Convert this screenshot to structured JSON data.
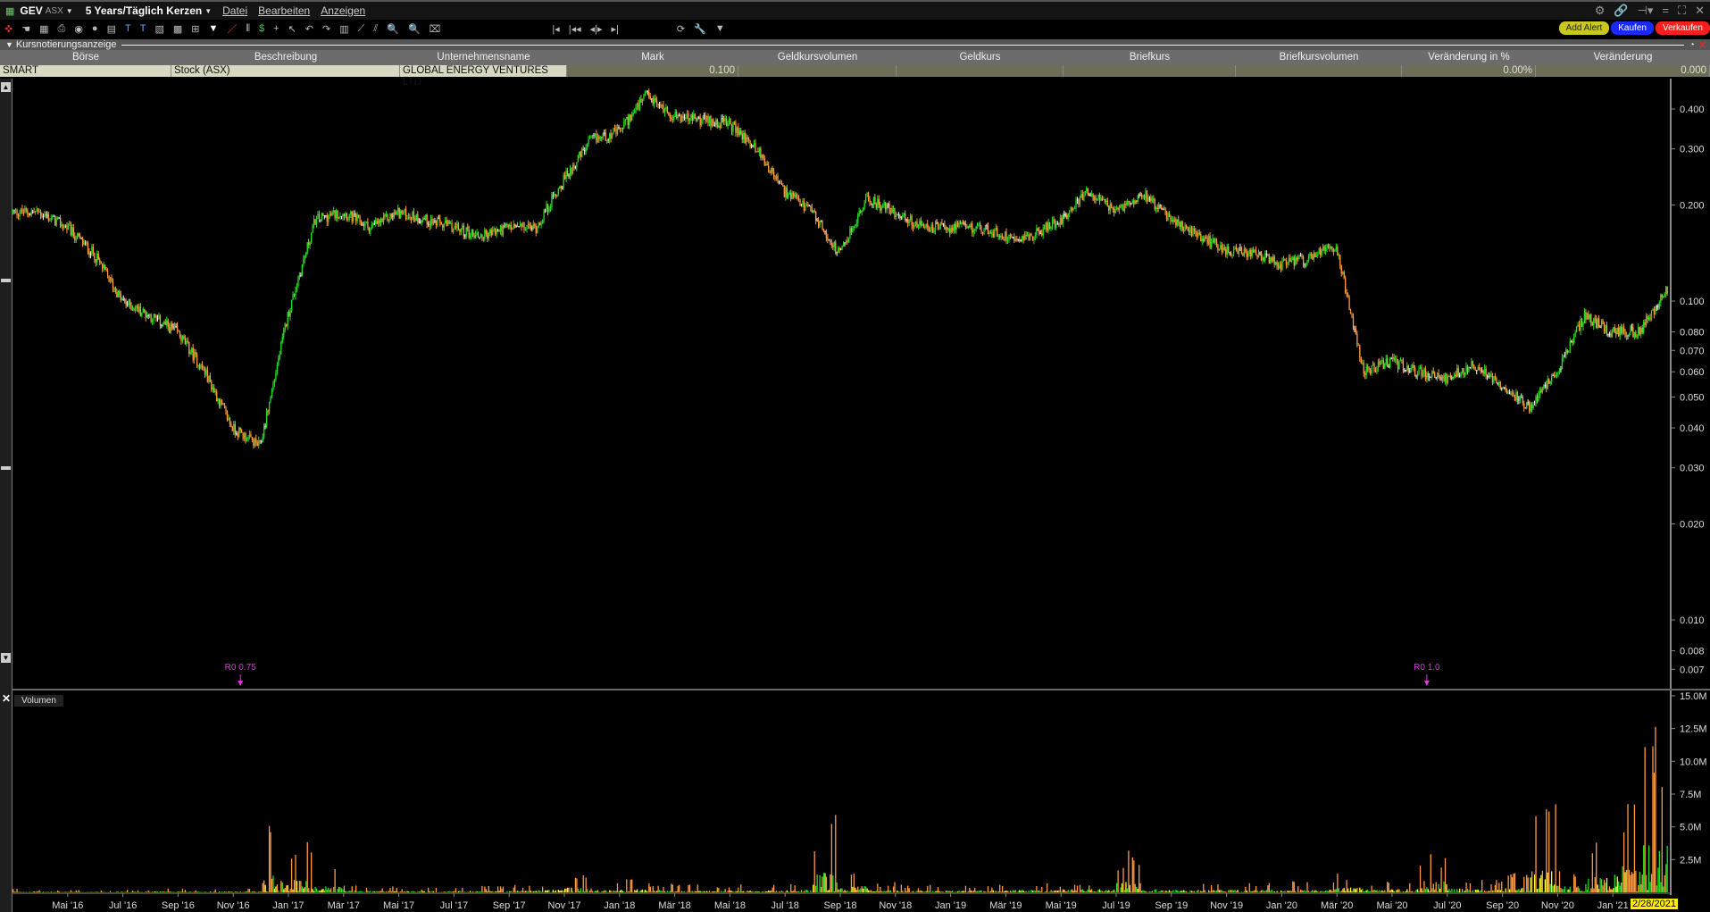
{
  "window": {
    "symbol": "GEV",
    "exchange": "ASX",
    "period": "5 Years/Täglich Kerzen",
    "menus": [
      "Datei",
      "Bearbeiten",
      "Anzeigen"
    ]
  },
  "buttons": {
    "add_alert": "Add Alert",
    "buy": "Kaufen",
    "sell": "Verkaufen"
  },
  "panel": {
    "title": "Kursnotierungsanzeige"
  },
  "quote": {
    "columns": [
      "Börse",
      "Beschreibung",
      "Unternehmensname",
      "Mark",
      "Geldkursvolumen",
      "Geldkurs",
      "Briefkurs",
      "Briefkursvolumen",
      "Veränderung in %",
      "Veränderung"
    ],
    "row": [
      "SMART",
      "Stock (ASX)",
      "GLOBAL ENERGY VENTURES LTD",
      "0.100",
      "",
      "",
      "",
      "",
      "0.00%",
      "0.000"
    ]
  },
  "volume_panel": {
    "label": "Volumen"
  },
  "cursor_date": "2/28/2021",
  "colors": {
    "up": "#22dd22",
    "down": "#ff9a40",
    "neutral": "#ffff33",
    "marker": "#dd33dd"
  },
  "chart_data": [
    {
      "type": "candlestick",
      "scale": "log",
      "months": [
        "2016-03",
        "2016-04",
        "2016-05",
        "2016-06",
        "2016-07",
        "2016-08",
        "2016-09",
        "2016-10",
        "2016-11",
        "2016-12",
        "2017-01",
        "2017-02",
        "2017-03",
        "2017-04",
        "2017-05",
        "2017-06",
        "2017-07",
        "2017-08",
        "2017-09",
        "2017-10",
        "2017-11",
        "2017-12",
        "2018-01",
        "2018-02",
        "2018-03",
        "2018-04",
        "2018-05",
        "2018-06",
        "2018-07",
        "2018-08",
        "2018-09",
        "2018-10",
        "2018-11",
        "2018-12",
        "2019-01",
        "2019-02",
        "2019-03",
        "2019-04",
        "2019-05",
        "2019-06",
        "2019-07",
        "2019-08",
        "2019-09",
        "2019-10",
        "2019-11",
        "2019-12",
        "2020-01",
        "2020-02",
        "2020-03",
        "2020-04",
        "2020-05",
        "2020-06",
        "2020-07",
        "2020-08",
        "2020-09",
        "2020-10",
        "2020-11",
        "2020-12",
        "2021-01",
        "2021-02"
      ],
      "close": [
        0.19,
        0.17,
        0.14,
        0.1,
        0.09,
        0.08,
        0.06,
        0.04,
        0.035,
        0.09,
        0.18,
        0.19,
        0.17,
        0.19,
        0.18,
        0.17,
        0.16,
        0.17,
        0.17,
        0.24,
        0.32,
        0.34,
        0.44,
        0.38,
        0.37,
        0.36,
        0.3,
        0.22,
        0.19,
        0.14,
        0.21,
        0.19,
        0.17,
        0.17,
        0.17,
        0.16,
        0.16,
        0.18,
        0.22,
        0.19,
        0.22,
        0.18,
        0.16,
        0.145,
        0.14,
        0.13,
        0.135,
        0.15,
        0.06,
        0.065,
        0.06,
        0.057,
        0.063,
        0.055,
        0.046,
        0.06,
        0.09,
        0.08,
        0.08,
        0.11
      ],
      "yticks": [
        0.4,
        0.3,
        0.2,
        0.1,
        0.08,
        0.07,
        0.06,
        0.05,
        0.04,
        0.03,
        0.02,
        0.01,
        0.008,
        0.007
      ],
      "yticklabels": [
        "0.400",
        "0.300",
        "0.200",
        "0.100",
        "0.080",
        "0.070",
        "0.060",
        "0.050",
        "0.040",
        "0.030",
        "0.020",
        "0.010",
        "0.008",
        "0.007"
      ],
      "xticklabels": [
        "Mai '16",
        "Jul '16",
        "Sep '16",
        "Nov '16",
        "Jan '17",
        "Mär '17",
        "Mai '17",
        "Jul '17",
        "Sep '17",
        "Nov '17",
        "Jan '18",
        "Mär '18",
        "Mai '18",
        "Jul '18",
        "Sep '18",
        "Nov '18",
        "Jan '19",
        "Mär '19",
        "Mai '19",
        "Jul '19",
        "Sep '19",
        "Nov '19",
        "Jan '20",
        "Mär '20",
        "Mai '20",
        "Jul '20",
        "Sep '20",
        "Nov '20",
        "Jan '21"
      ],
      "annotations": [
        {
          "month": "2016-11",
          "text": "R0 0.75"
        },
        {
          "month": "2020-06",
          "text": "R0 1.0"
        }
      ]
    },
    {
      "type": "bar",
      "name": "Volumen",
      "unit": "M",
      "monthly_peak_volume": [
        0.3,
        0.2,
        0.2,
        0.2,
        0.2,
        0.3,
        0.3,
        0.3,
        0.3,
        5.5,
        4,
        2,
        0.6,
        0.5,
        0.4,
        0.4,
        0.5,
        0.5,
        0.6,
        0.8,
        1.5,
        0.8,
        1,
        0.7,
        0.6,
        0.5,
        0.6,
        0.6,
        0.8,
        6,
        2,
        0.8,
        0.6,
        0.6,
        0.6,
        0.7,
        0.8,
        0.8,
        1,
        1,
        3.2,
        1,
        0.8,
        0.8,
        0.8,
        0.9,
        0.9,
        1,
        1.5,
        1,
        1,
        3.5,
        1.2,
        1,
        1.5,
        7,
        2,
        5,
        8,
        15
      ],
      "yticks": [
        2.5,
        5,
        7.5,
        10,
        12.5,
        15
      ],
      "yticklabels": [
        "2.5M",
        "5.0M",
        "7.5M",
        "10.0M",
        "12.5M",
        "15.0M"
      ]
    }
  ]
}
